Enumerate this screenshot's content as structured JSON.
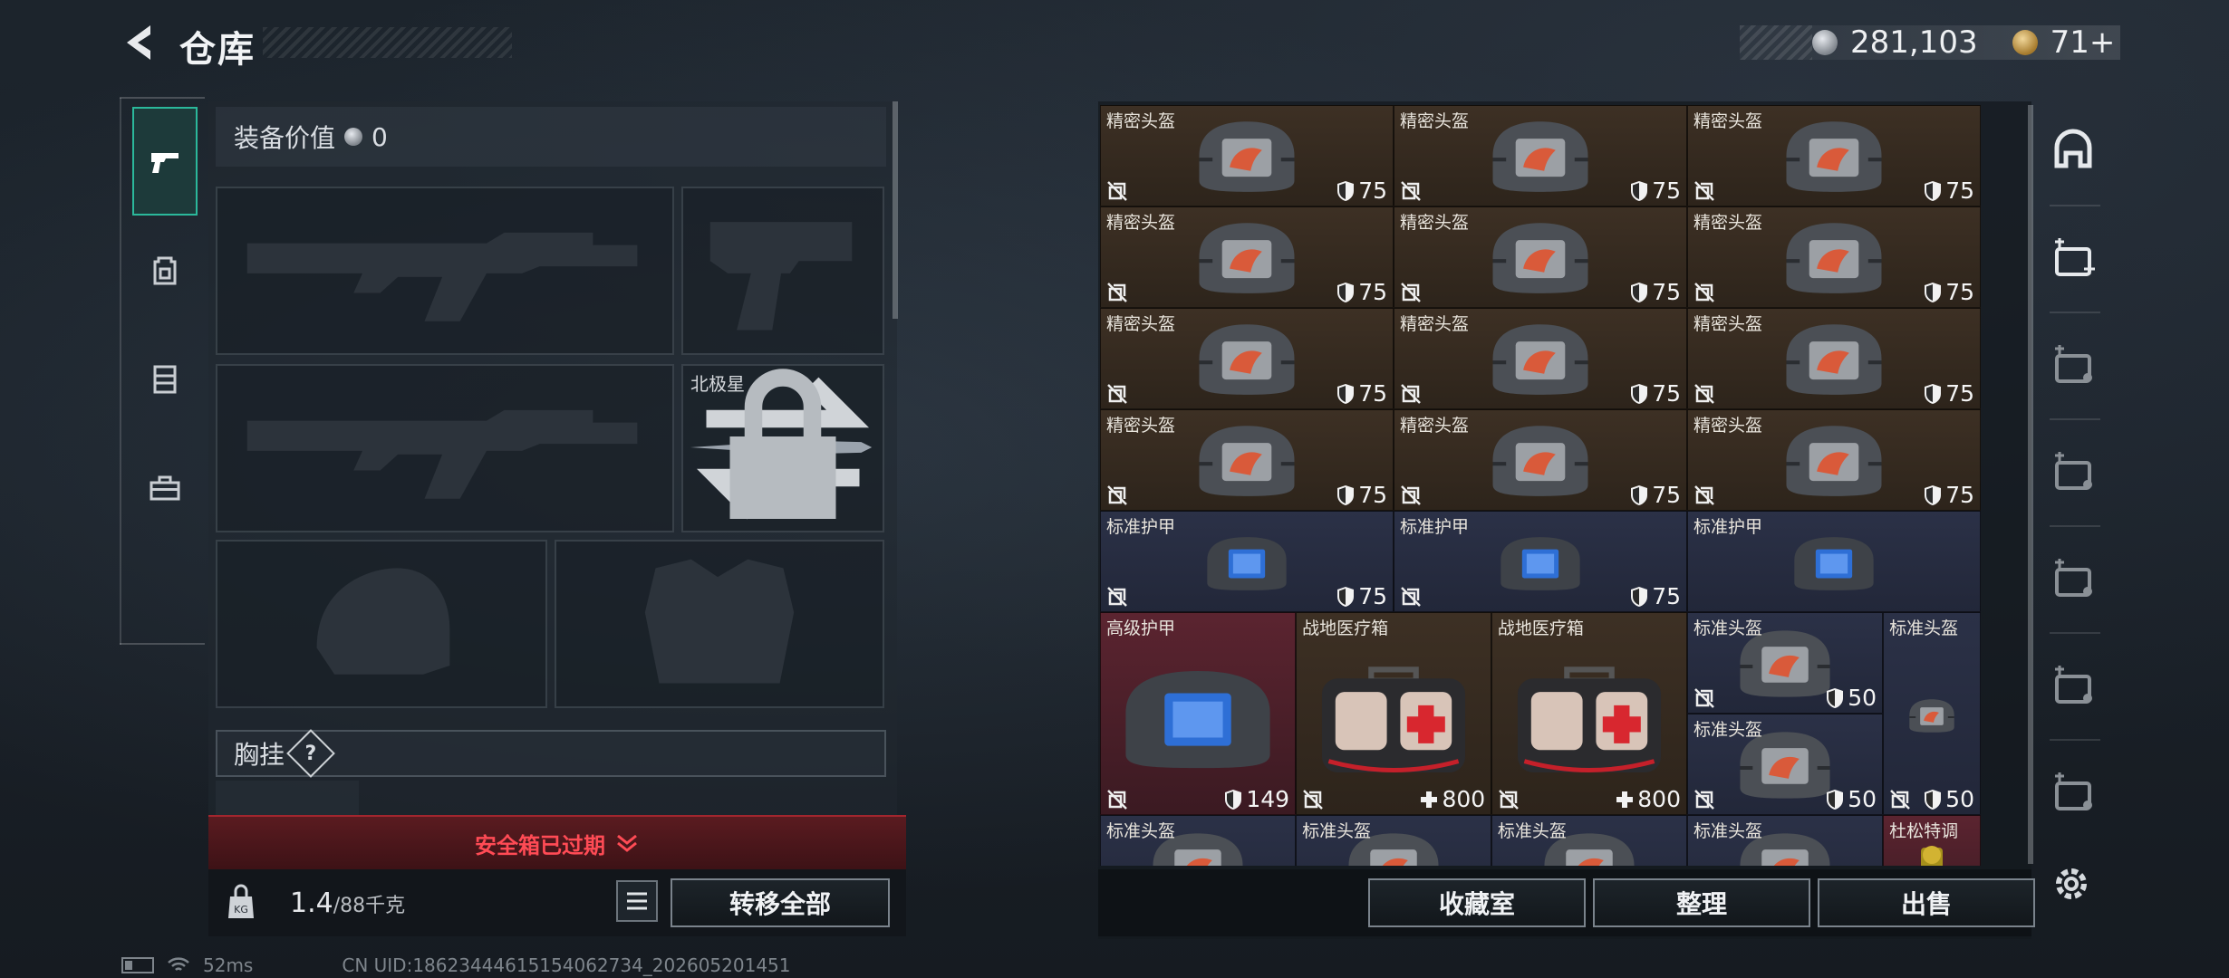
{
  "header": {
    "title": "仓库",
    "back_icon": "chevron-left-icon"
  },
  "currency": [
    {
      "icon": "silver-coin-icon",
      "value": "281,103"
    },
    {
      "icon": "gold-coin-icon",
      "value": "71+"
    }
  ],
  "left_sidebar": [
    {
      "name": "weapons",
      "icon": "pistol-icon",
      "active": true
    },
    {
      "name": "backpack",
      "icon": "backpack-icon",
      "active": false
    },
    {
      "name": "vest",
      "icon": "chest-rig-icon",
      "active": false
    },
    {
      "name": "toolbox",
      "icon": "toolbox-icon",
      "active": false
    }
  ],
  "equipment": {
    "value_label": "装备价值",
    "value": "0",
    "slots": [
      "primary-rifle-slot",
      "pistol-slot",
      "secondary-rifle-slot",
      "melee-slot",
      "helmet-slot",
      "armor-slot"
    ],
    "melee_name": "北极星",
    "chest_rig_label": "胸挂",
    "chest_rig_help": "?"
  },
  "safe_box": {
    "expired_text": "安全箱已过期"
  },
  "bottom_left": {
    "weight": "1.4",
    "capacity": "/88千克",
    "transfer_all": "转移全部"
  },
  "grid_items": [
    {
      "name": "精密头盔",
      "value": "75",
      "type": "helmet",
      "color": "brown"
    },
    {
      "name": "精密头盔",
      "value": "75",
      "type": "helmet",
      "color": "brown"
    },
    {
      "name": "精密头盔",
      "value": "75",
      "type": "helmet",
      "color": "brown"
    },
    {
      "name": "精密头盔",
      "value": "75",
      "type": "helmet",
      "color": "brown"
    },
    {
      "name": "精密头盔",
      "value": "75",
      "type": "helmet",
      "color": "brown"
    },
    {
      "name": "精密头盔",
      "value": "75",
      "type": "helmet",
      "color": "brown"
    },
    {
      "name": "精密头盔",
      "value": "75",
      "type": "helmet",
      "color": "brown"
    },
    {
      "name": "精密头盔",
      "value": "75",
      "type": "helmet",
      "color": "brown"
    },
    {
      "name": "精密头盔",
      "value": "75",
      "type": "helmet",
      "color": "brown"
    },
    {
      "name": "精密头盔",
      "value": "75",
      "type": "helmet",
      "color": "brown"
    },
    {
      "name": "精密头盔",
      "value": "75",
      "type": "helmet",
      "color": "brown"
    },
    {
      "name": "精密头盔",
      "value": "75",
      "type": "helmet",
      "color": "brown"
    },
    {
      "name": "标准护甲",
      "value": "75",
      "type": "armor",
      "color": "blue"
    },
    {
      "name": "标准护甲",
      "value": "75",
      "type": "armor",
      "color": "blue"
    },
    {
      "name": "标准护甲",
      "value": "",
      "type": "armor",
      "color": "blue"
    },
    {
      "name": "高级护甲",
      "value": "149",
      "type": "armor",
      "color": "red"
    },
    {
      "name": "战地医疗箱",
      "value": "800",
      "type": "medkit",
      "color": "brown"
    },
    {
      "name": "战地医疗箱",
      "value": "800",
      "type": "medkit",
      "color": "brown"
    },
    {
      "name": "标准头盔",
      "value": "50",
      "type": "helmet",
      "color": "blue"
    },
    {
      "name": "标准头盔",
      "value": "50",
      "type": "helmet",
      "color": "blue"
    },
    {
      "name": "标准头盔",
      "value": "50",
      "type": "helmet",
      "color": "blue"
    },
    {
      "name": "标准头盔",
      "value": "",
      "type": "helmet",
      "color": "blue"
    },
    {
      "name": "标准头盔",
      "value": "",
      "type": "helmet",
      "color": "blue"
    },
    {
      "name": "标准头盔",
      "value": "",
      "type": "helmet",
      "color": "blue"
    },
    {
      "name": "标准头盔",
      "value": "",
      "type": "helmet",
      "color": "blue"
    },
    {
      "name": "杜松特调",
      "value": "",
      "type": "drink",
      "color": "red"
    }
  ],
  "actions": {
    "collection": "收藏室",
    "sort": "整理",
    "sell": "出售"
  },
  "right_sidebar": [
    "storage-icon",
    "container-1-icon",
    "container-2-icon",
    "container-3-icon",
    "container-4-icon",
    "container-5-icon",
    "container-6-icon"
  ],
  "status_bar": {
    "ping": "52ms",
    "uid": "CN UID:18623444615154062734_202605201451"
  },
  "colors": {
    "accent": "#2bb89b",
    "danger": "#ff4b55",
    "brown_cell": "#3d3024",
    "blue_cell": "#2b3147",
    "red_cell": "#5b2430"
  }
}
